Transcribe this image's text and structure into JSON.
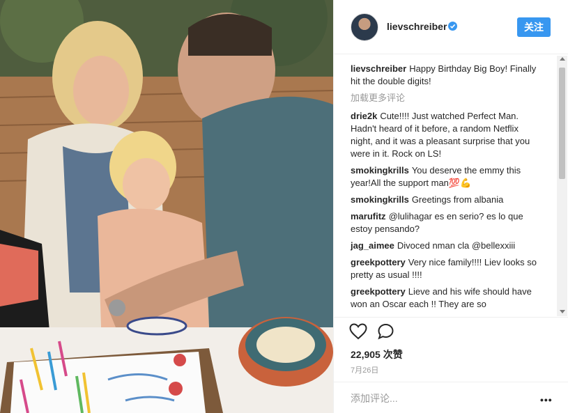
{
  "post": {
    "username": "lievschreiber",
    "follow_label": "关注",
    "load_more_label": "加载更多评论",
    "likes_text": "22,905 次赞",
    "date_text": "7月26日",
    "add_comment_placeholder": "添加评论...",
    "more_label": "•••",
    "accent_color": "#3897f0"
  },
  "caption": {
    "user": "lievschreiber",
    "text": "Happy Birthday Big Boy! Finally hit the double digits!"
  },
  "comments": [
    {
      "user": "drie2k",
      "text": "Cute!!!! Just watched Perfect Man. Hadn't heard of it before, a random Netflix night, and it was a pleasant surprise that you were in it. Rock on LS!"
    },
    {
      "user": "smokingkrills",
      "text": "You deserve the emmy this year!All the support man💯💪"
    },
    {
      "user": "smokingkrills",
      "text": "Greetings from albania"
    },
    {
      "user": "marufitz",
      "text": "@lulihagar es en serio? es lo que estoy pensando?"
    },
    {
      "user": "jag_aimee",
      "text": "Divoced nman cla @bellexxiii"
    },
    {
      "user": "greekpottery",
      "text": "Very nice family!!!! Liev looks so pretty as usual !!!!"
    },
    {
      "user": "greekpottery",
      "text": "Lieve and his wife should have won an Oscar each !! They are so"
    }
  ],
  "icons": {
    "heart": "heart-icon",
    "comment": "comment-icon",
    "verified": "verified-badge-icon",
    "more": "more-options-icon"
  }
}
